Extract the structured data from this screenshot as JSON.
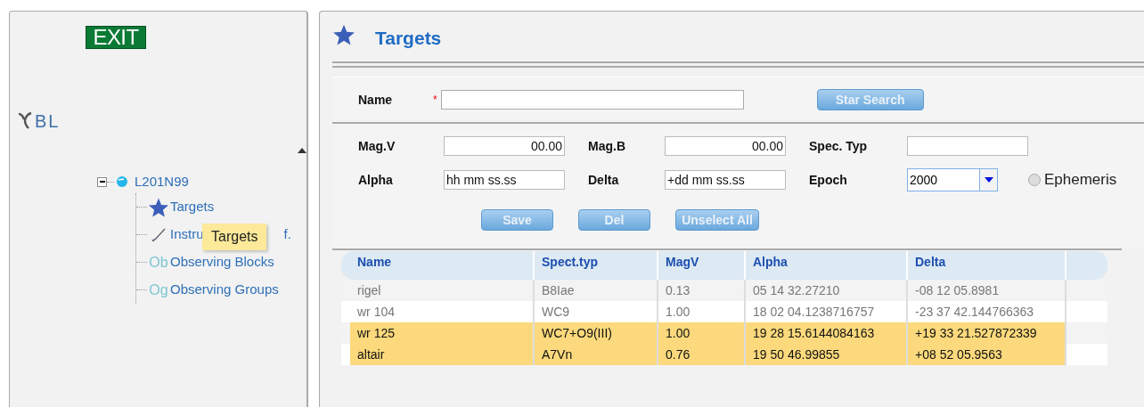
{
  "sidebar": {
    "exit_label": "EXIT",
    "logo_text": "BL",
    "tree": [
      {
        "label": "L201N99",
        "expanded": true,
        "children": [
          {
            "kind": "star",
            "label": "Targets"
          },
          {
            "kind": "tool",
            "label": "Instru",
            "label_tail": "f."
          },
          {
            "kind": "badge",
            "badge": "Ob",
            "label": "Observing Blocks"
          },
          {
            "kind": "badge",
            "badge": "Og",
            "label": "Observing Groups"
          }
        ]
      }
    ],
    "tooltip": "Targets"
  },
  "page": {
    "title": "Targets",
    "form": {
      "name_label": "Name",
      "required_mark": "*",
      "star_search": "Star Search",
      "fields": [
        {
          "label": "Mag.V",
          "value": "00.00",
          "kind": "number"
        },
        {
          "label": "Mag.B",
          "value": "00.00",
          "kind": "number"
        },
        {
          "label": "Spec. Typ",
          "kind": "text"
        },
        {
          "label": "Alpha",
          "value": "hh mm ss.ss",
          "kind": "text"
        },
        {
          "label": "Delta",
          "value": "+dd mm ss.ss",
          "kind": "text"
        },
        {
          "label": "Epoch",
          "value": "2000",
          "kind": "select"
        }
      ],
      "ephemeris": {
        "label": "Ephemeris",
        "checked": false
      },
      "buttons": [
        "Save",
        "Del",
        "Unselect All"
      ]
    },
    "table": {
      "columns": [
        "Name",
        "Spect.typ",
        "MagV",
        "Alpha",
        "Delta"
      ],
      "rows": [
        {
          "cells": [
            "rigel",
            "B8Iae",
            "0.13",
            "05 14 32.27210",
            "-08 12 05.8981"
          ],
          "selected": false
        },
        {
          "cells": [
            "wr 104",
            "WC9",
            "1.00",
            "18 02 04.1238716757",
            "-23 37 42.144766363"
          ],
          "selected": false
        },
        {
          "cells": [
            "wr 125",
            "WC7+O9(III)",
            "1.00",
            "19 28 15.6144084163",
            "+19 33 21.527872339"
          ],
          "selected": true
        },
        {
          "cells": [
            "altair",
            "A7Vn",
            "0.76",
            "19 50 46.99855",
            "+08 52 05.9563"
          ],
          "selected": true
        }
      ]
    }
  }
}
